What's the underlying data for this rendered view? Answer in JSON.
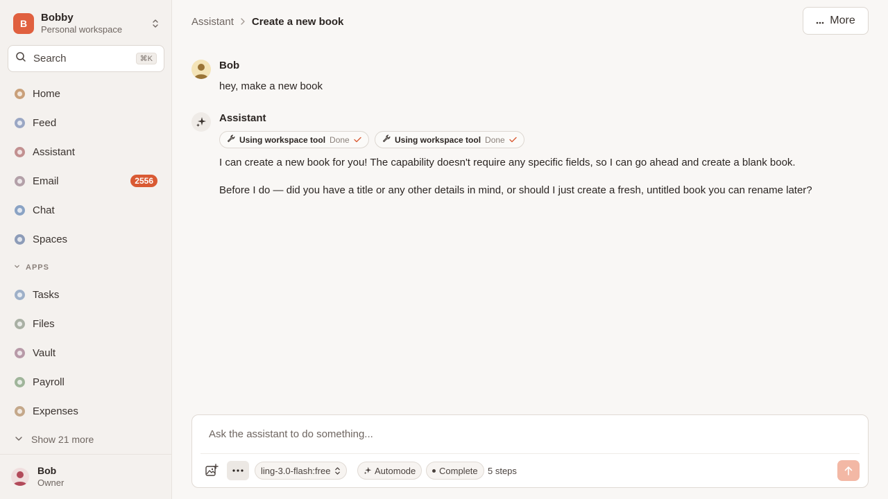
{
  "workspace": {
    "initial": "B",
    "name": "Bobby",
    "subtitle": "Personal workspace"
  },
  "search": {
    "label": "Search",
    "shortcut": "⌘K"
  },
  "nav": [
    {
      "label": "Home",
      "color": "#c9a07a"
    },
    {
      "label": "Feed",
      "color": "#9aa7c4"
    },
    {
      "label": "Assistant",
      "color": "#c29090"
    },
    {
      "label": "Email",
      "color": "#b3a0a8",
      "badge": "2556"
    },
    {
      "label": "Chat",
      "color": "#8aa3c4"
    },
    {
      "label": "Spaces",
      "color": "#8d9cb8"
    }
  ],
  "apps_section": {
    "label": "APPS"
  },
  "apps": [
    {
      "label": "Tasks",
      "color": "#9eb0c8"
    },
    {
      "label": "Files",
      "color": "#a9b0a4"
    },
    {
      "label": "Vault",
      "color": "#b89aa8"
    },
    {
      "label": "Payroll",
      "color": "#9fb59a"
    },
    {
      "label": "Expenses",
      "color": "#c4a88a"
    }
  ],
  "show_more": {
    "label": "Show 21 more"
  },
  "user": {
    "name": "Bob",
    "role": "Owner"
  },
  "breadcrumb": {
    "parent": "Assistant",
    "current": "Create a new book"
  },
  "header": {
    "more_label": "More"
  },
  "messages": {
    "user": {
      "name": "Bob",
      "text": "hey, make a new book"
    },
    "assistant": {
      "name": "Assistant",
      "tools": [
        {
          "label": "Using workspace tool",
          "status": "Done"
        },
        {
          "label": "Using workspace tool",
          "status": "Done"
        }
      ],
      "paragraphs": [
        "I can create a new book for you! The capability doesn't require any specific fields, so I can go ahead and create a blank book.",
        "Before I do — did you have a title or any other details in mind, or should I just create a fresh, untitled book you can rename later?"
      ]
    }
  },
  "composer": {
    "placeholder": "Ask the assistant to do something...",
    "model": "ling-3.0-flash:free",
    "automode": "Automode",
    "complete": "Complete",
    "steps": "5 steps"
  },
  "colors": {
    "accent": "#e0603f",
    "badge": "#d95a33",
    "send": "#f3b8a5"
  }
}
